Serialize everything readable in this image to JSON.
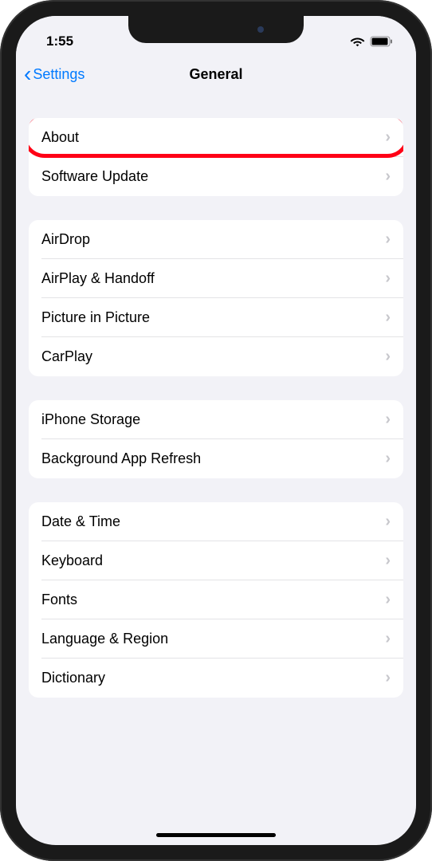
{
  "status": {
    "time": "1:55"
  },
  "nav": {
    "back_label": "Settings",
    "title": "General"
  },
  "sections": [
    {
      "rows": [
        {
          "label": "About"
        },
        {
          "label": "Software Update"
        }
      ]
    },
    {
      "rows": [
        {
          "label": "AirDrop"
        },
        {
          "label": "AirPlay & Handoff"
        },
        {
          "label": "Picture in Picture"
        },
        {
          "label": "CarPlay"
        }
      ]
    },
    {
      "rows": [
        {
          "label": "iPhone Storage"
        },
        {
          "label": "Background App Refresh"
        }
      ]
    },
    {
      "rows": [
        {
          "label": "Date & Time"
        },
        {
          "label": "Keyboard"
        },
        {
          "label": "Fonts"
        },
        {
          "label": "Language & Region"
        },
        {
          "label": "Dictionary"
        }
      ]
    }
  ]
}
